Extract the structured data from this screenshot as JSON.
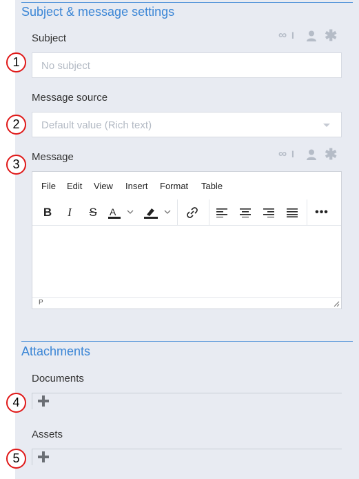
{
  "subject_section": {
    "title": "Subject & message settings",
    "subject": {
      "label": "Subject",
      "placeholder": "No subject"
    },
    "message_source": {
      "label": "Message source",
      "selected": "Default value (Rich text)"
    },
    "message": {
      "label": "Message",
      "menu": [
        "File",
        "Edit",
        "View",
        "Insert",
        "Format",
        "Table"
      ],
      "statusbar_path": "P"
    }
  },
  "field_icons": [
    "link-variable-icon",
    "person-icon",
    "asterisk-icon"
  ],
  "attachments_section": {
    "title": "Attachments",
    "documents": {
      "label": "Documents"
    },
    "assets": {
      "label": "Assets"
    }
  },
  "markers": [
    "1",
    "2",
    "3",
    "4",
    "5"
  ],
  "colors": {
    "accent": "#3b86d6",
    "panel": "#e8ebf2",
    "marker_ring": "#e01818",
    "icon_muted": "#b5bcc7"
  }
}
